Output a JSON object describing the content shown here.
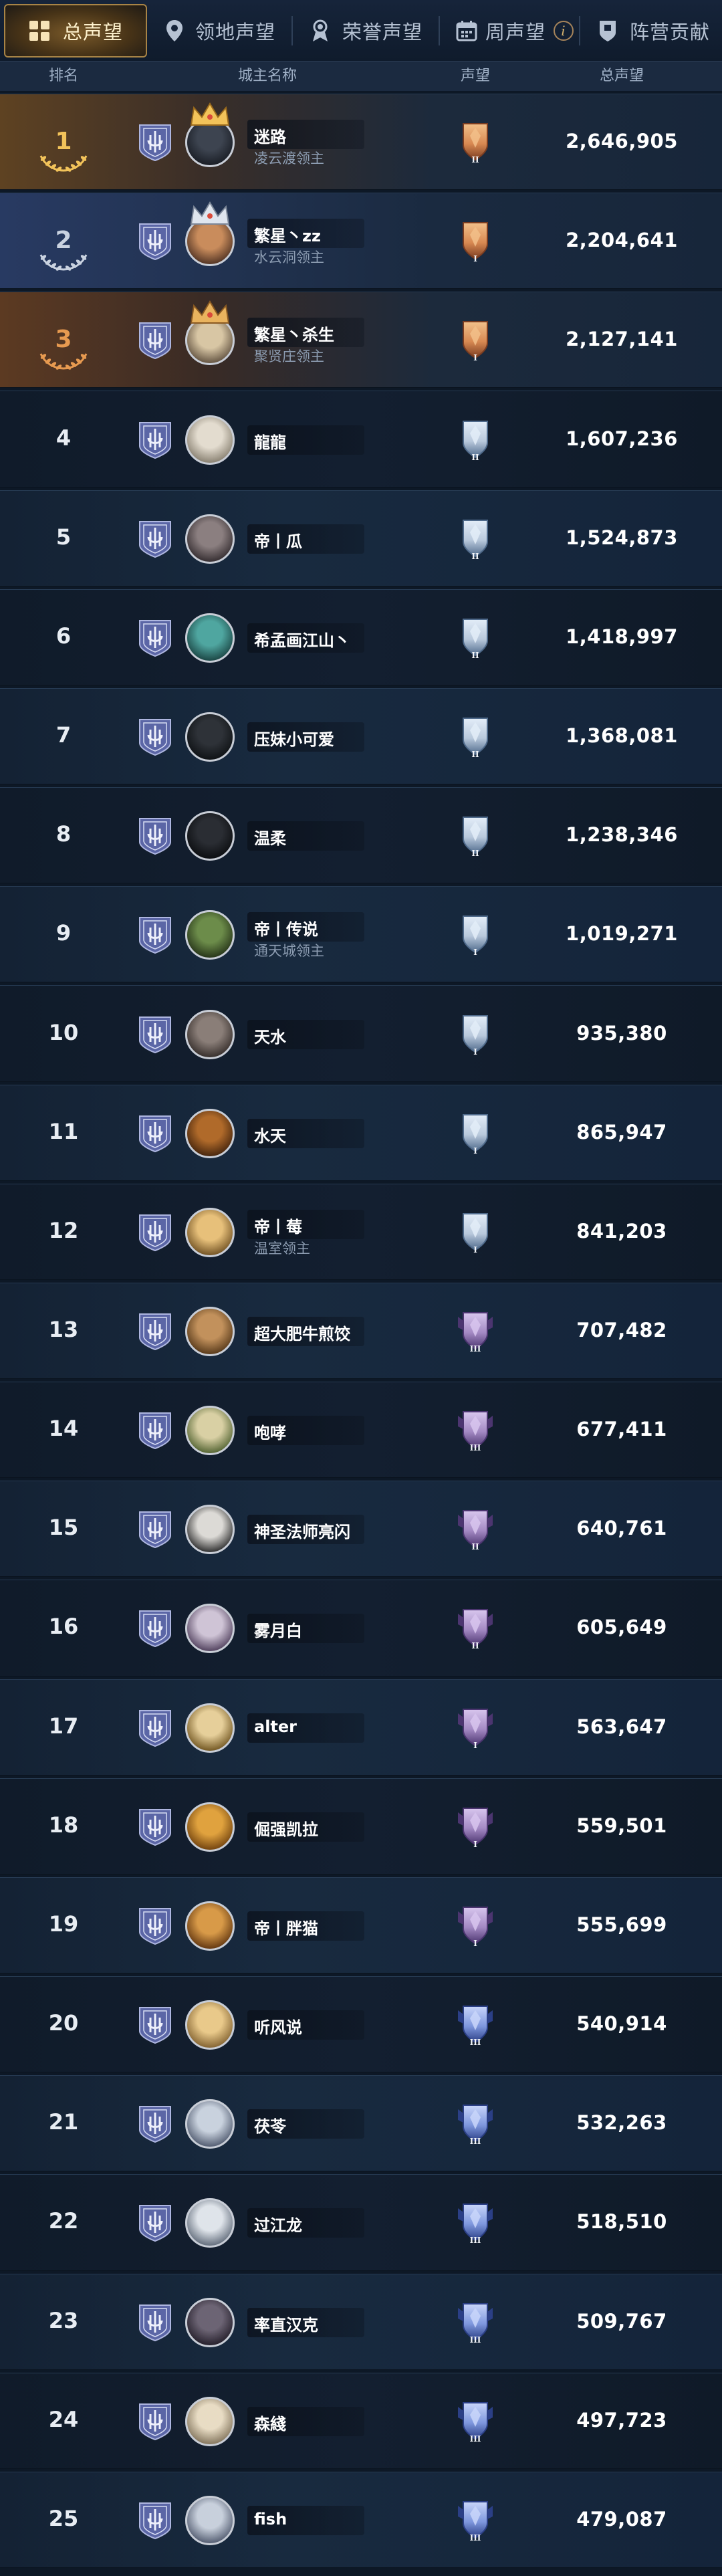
{
  "tabs": [
    {
      "label": "总声望",
      "icon": "grid-icon",
      "active": true
    },
    {
      "label": "领地声望",
      "icon": "location-pin-icon",
      "active": false
    },
    {
      "label": "荣誉声望",
      "icon": "medal-icon",
      "active": false
    },
    {
      "label": "周声望",
      "icon": "calendar-icon",
      "active": false,
      "info": "i"
    },
    {
      "label": "阵营贡献",
      "icon": "shield-flag-icon",
      "active": false
    }
  ],
  "header": {
    "rank": "排名",
    "name": "城主名称",
    "prestige": "声望",
    "total": "总声望"
  },
  "rows": [
    {
      "rank": "1",
      "name": "迷路",
      "subtitle": "凌云渡领主",
      "score": "2,646,905",
      "tier": "bronze",
      "level": "II",
      "crown": "gold"
    },
    {
      "rank": "2",
      "name": "繁星丶zz",
      "subtitle": "水云洞领主",
      "score": "2,204,641",
      "tier": "bronze",
      "level": "I",
      "crown": "silver"
    },
    {
      "rank": "3",
      "name": "繁星丶杀生",
      "subtitle": "聚贤庄领主",
      "score": "2,127,141",
      "tier": "bronze",
      "level": "I",
      "crown": "bronze"
    },
    {
      "rank": "4",
      "name": "龍龍",
      "subtitle": "",
      "score": "1,607,236",
      "tier": "silver",
      "level": "II"
    },
    {
      "rank": "5",
      "name": "帝丨瓜",
      "subtitle": "",
      "score": "1,524,873",
      "tier": "silver",
      "level": "II"
    },
    {
      "rank": "6",
      "name": "希孟画江山丶",
      "subtitle": "",
      "score": "1,418,997",
      "tier": "silver",
      "level": "II"
    },
    {
      "rank": "7",
      "name": "压妹小可爱",
      "subtitle": "",
      "score": "1,368,081",
      "tier": "silver",
      "level": "II"
    },
    {
      "rank": "8",
      "name": "温柔",
      "subtitle": "",
      "score": "1,238,346",
      "tier": "silver",
      "level": "II"
    },
    {
      "rank": "9",
      "name": "帝丨传说",
      "subtitle": "通天城领主",
      "score": "1,019,271",
      "tier": "silver",
      "level": "I"
    },
    {
      "rank": "10",
      "name": "天水",
      "subtitle": "",
      "score": "935,380",
      "tier": "silver",
      "level": "I"
    },
    {
      "rank": "11",
      "name": "水天",
      "subtitle": "",
      "score": "865,947",
      "tier": "silver",
      "level": "I"
    },
    {
      "rank": "12",
      "name": "帝丨莓",
      "subtitle": "温室领主",
      "score": "841,203",
      "tier": "silver",
      "level": "I"
    },
    {
      "rank": "13",
      "name": "超大肥牛煎饺",
      "subtitle": "",
      "score": "707,482",
      "tier": "purple",
      "level": "III"
    },
    {
      "rank": "14",
      "name": "咆哮",
      "subtitle": "",
      "score": "677,411",
      "tier": "purple",
      "level": "III"
    },
    {
      "rank": "15",
      "name": "神圣法师亮闪",
      "subtitle": "",
      "score": "640,761",
      "tier": "purple",
      "level": "II"
    },
    {
      "rank": "16",
      "name": "雾月白",
      "subtitle": "",
      "score": "605,649",
      "tier": "purple",
      "level": "II"
    },
    {
      "rank": "17",
      "name": "alter",
      "subtitle": "",
      "score": "563,647",
      "tier": "purple",
      "level": "I"
    },
    {
      "rank": "18",
      "name": "倔强凯拉",
      "subtitle": "",
      "score": "559,501",
      "tier": "purple",
      "level": "I"
    },
    {
      "rank": "19",
      "name": "帝丨胖猫",
      "subtitle": "",
      "score": "555,699",
      "tier": "purple",
      "level": "I"
    },
    {
      "rank": "20",
      "name": "听风说",
      "subtitle": "",
      "score": "540,914",
      "tier": "blue",
      "level": "III"
    },
    {
      "rank": "21",
      "name": "茯苓",
      "subtitle": "",
      "score": "532,263",
      "tier": "blue",
      "level": "III"
    },
    {
      "rank": "22",
      "name": "过江龙",
      "subtitle": "",
      "score": "518,510",
      "tier": "blue",
      "level": "III"
    },
    {
      "rank": "23",
      "name": "率直汉克",
      "subtitle": "",
      "score": "509,767",
      "tier": "blue",
      "level": "III"
    },
    {
      "rank": "24",
      "name": "森綫",
      "subtitle": "",
      "score": "497,723",
      "tier": "blue",
      "level": "III"
    },
    {
      "rank": "25",
      "name": "fish",
      "subtitle": "",
      "score": "479,087",
      "tier": "blue",
      "level": "III"
    }
  ],
  "colors": {
    "gold": "#f2c35a",
    "silver": "#c9d2e0",
    "bronze": "#e79a50",
    "badge_bronze": "#b8683a",
    "badge_silver": "#9fb4cc",
    "badge_purple": "#8c6fb0",
    "badge_blue": "#5a77c8",
    "guild_icon": "#5b66a6"
  }
}
